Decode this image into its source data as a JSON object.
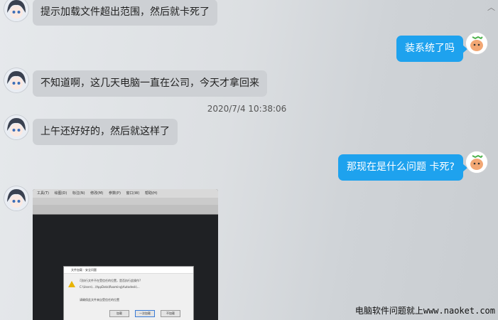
{
  "chat": {
    "timestamp": "2020/7/4 10:38:06",
    "messages": [
      {
        "side": "in",
        "text": "提示加载文件超出范围，然后就卡死了"
      },
      {
        "side": "out",
        "text": "装系统了吗"
      },
      {
        "side": "in",
        "text": "不知道啊，这几天电脑一直在公司，今天才拿回来"
      },
      {
        "side": "in",
        "text": "上午还好好的，然后就这样了"
      },
      {
        "side": "out",
        "text": "那现在是什么问题 卡死?"
      }
    ]
  },
  "screenshot": {
    "menu": [
      "工具(T)",
      "绘图(D)",
      "标注(N)",
      "修改(M)",
      "参数(P)",
      "窗口(W)",
      "帮助(H)"
    ],
    "dialog_title": "文件加载 - 安全问题",
    "dialog_line1": "可执行文件不在受信任的位置，是否执行此操作?",
    "dialog_line2": "C:\\Users\\...\\AppData\\Roaming\\Autodesk\\...",
    "dialog_line3": "请确保此文件来自受信任的位置",
    "buttons": [
      "加载",
      "一次加载",
      "不加载"
    ]
  },
  "watermark": "电脑软件问题就上www.naoket.com",
  "scroll_icon": "chevron-up-icon",
  "colors": {
    "outgoing_bubble": "#1ea2ee",
    "incoming_bubble": "#cdd0d4"
  }
}
